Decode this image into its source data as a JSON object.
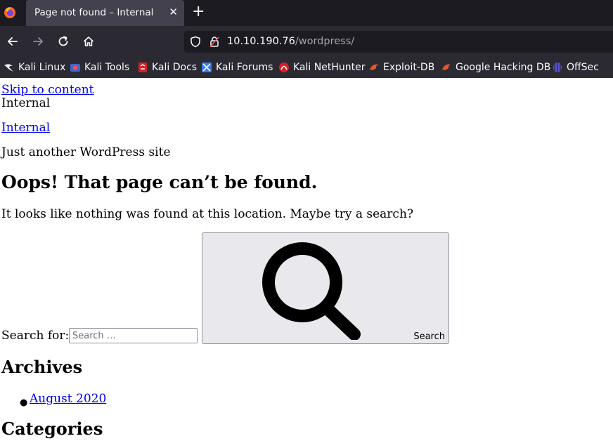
{
  "browser": {
    "tab_title": "Page not found – Internal",
    "tab_close": "✕",
    "new_tab": "+",
    "url_host": "10.10.190.76",
    "url_path": "/wordpress/",
    "bookmarks": [
      {
        "label": "Kali Linux",
        "icon": "kali-dragon-icon"
      },
      {
        "label": "Kali Tools",
        "icon": "kali-tools-icon"
      },
      {
        "label": "Kali Docs",
        "icon": "kali-docs-icon"
      },
      {
        "label": "Kali Forums",
        "icon": "kali-forums-icon"
      },
      {
        "label": "Kali NetHunter",
        "icon": "kali-nethunter-icon"
      },
      {
        "label": "Exploit-DB",
        "icon": "exploit-db-icon"
      },
      {
        "label": "Google Hacking DB",
        "icon": "google-hacking-db-icon"
      },
      {
        "label": "OffSec",
        "icon": "offsec-icon"
      }
    ],
    "colors": {
      "chrome_dark": "#1c1b22",
      "toolbar": "#2b2a33",
      "tab_active": "#42414d"
    }
  },
  "page": {
    "skip_link": "Skip to content",
    "site_name_text": "Internal",
    "site_title_link": "Internal",
    "tagline": "Just another WordPress site",
    "heading": "Oops! That page can’t be found.",
    "message": "It looks like nothing was found at this location. Maybe try a search?",
    "search": {
      "label": "Search for:",
      "placeholder": "Search …",
      "value": "",
      "button_label": "Search"
    },
    "archives_heading": "Archives",
    "archives": [
      "August 2020"
    ],
    "categories_heading": "Categories"
  }
}
